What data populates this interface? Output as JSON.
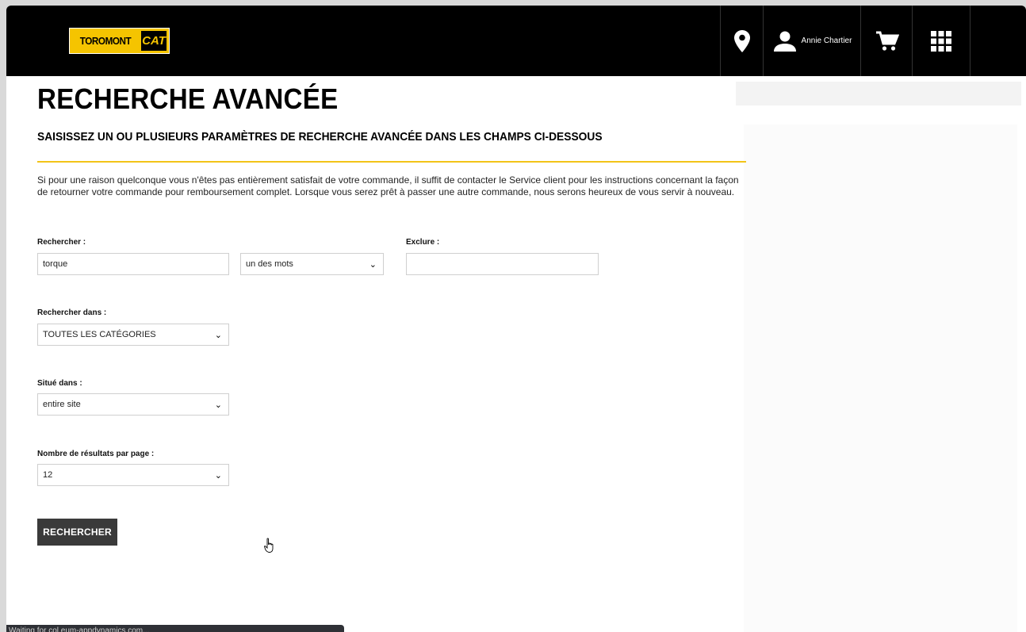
{
  "header": {
    "logo": {
      "left_text": "TOROMONT",
      "right_text": "CAT"
    },
    "user_name": "Annie Chartier",
    "icons": [
      "location-pin-icon",
      "user-icon",
      "cart-icon",
      "apps-grid-icon"
    ]
  },
  "page": {
    "title": "RECHERCHE AVANCÉE",
    "subtitle": "SAISISSEZ UN OU PLUSIEURS PARAMÈTRES DE RECHERCHE AVANCÉE DANS LES CHAMPS CI-DESSOUS",
    "intro": "Si pour une raison quelconque vous n'êtes pas entièrement satisfait de votre commande, il suffit de contacter le Service client pour les instructions concernant la façon de retourner votre commande pour remboursement complet. Lorsque vous serez prêt à passer une autre commande, nous serons heureux de vous servir à nouveau."
  },
  "form": {
    "search_label": "Rechercher :",
    "search_value": "torque",
    "match_mode": "un des mots",
    "exclude_label": "Exclure :",
    "exclude_value": "",
    "search_in_label": "Rechercher dans :",
    "search_in_value": "TOUTES LES CATÉGORIES",
    "located_in_label": "Situé dans :",
    "located_in_value": "entire site",
    "results_label": "Nombre de résultats par page :",
    "results_value": "12",
    "submit_label": "RECHERCHER"
  },
  "status_bar": "Waiting for col.eum-appdynamics.com...",
  "colors": {
    "accent": "#f2c418",
    "header_bg": "#000000",
    "button_bg": "#3a3a3a"
  }
}
